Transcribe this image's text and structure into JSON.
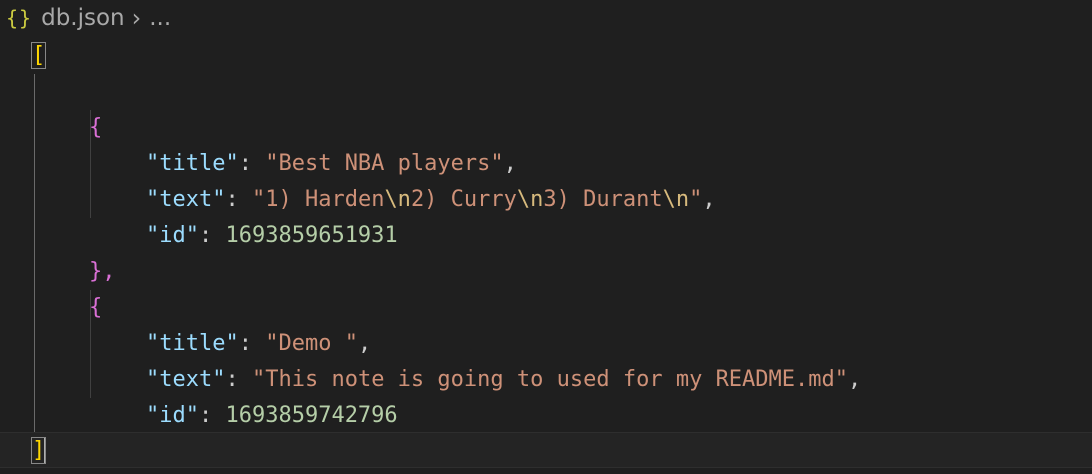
{
  "breadcrumb": {
    "file_icon": "{}",
    "file_name": "db.json",
    "separator": "›",
    "more": "..."
  },
  "editor": {
    "open_bracket": "[",
    "close_bracket": "]",
    "entries": [
      {
        "open": "{",
        "close": "},",
        "title_key": "\"title\"",
        "title_value": "\"Best NBA players\"",
        "text_key": "\"text\"",
        "text_value_parts": [
          "\"1) Harden",
          "\\n",
          "2) Curry",
          "\\n",
          "3) Durant",
          "\\n",
          "\""
        ],
        "id_key": "\"id\"",
        "id_value": "1693859651931"
      },
      {
        "open": "{",
        "close": "}",
        "title_key": "\"title\"",
        "title_value": "\"Demo \"",
        "text_key": "\"text\"",
        "text_value": "\"This note is going to used for my README.md\"",
        "id_key": "\"id\"",
        "id_value": "1693859742796"
      }
    ]
  },
  "colors": {
    "background": "#1f1f1f",
    "key": "#9cdcfe",
    "string": "#ce9178",
    "number": "#b5cea8",
    "escape": "#d7ba7d",
    "bracket_level1": "#ffd700",
    "bracket_level2": "#da70d6"
  }
}
